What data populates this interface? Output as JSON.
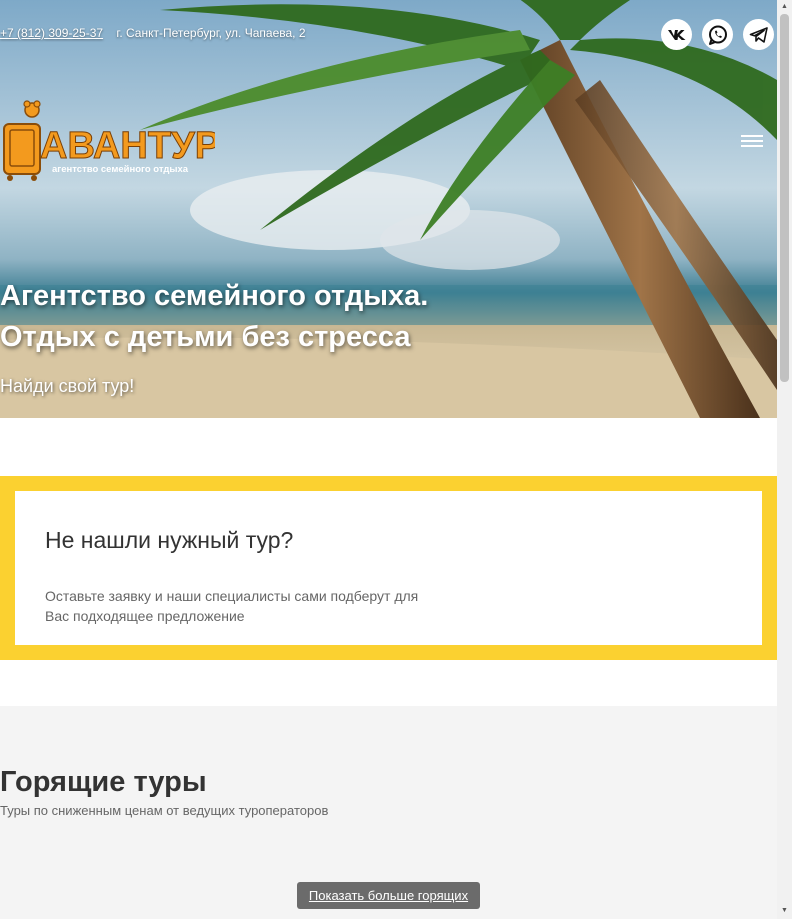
{
  "header": {
    "phone": "+7 (812) 309-25-37",
    "address": "г. Санкт-Петербург, ул. Чапаева, 2"
  },
  "social": [
    {
      "name": "vk-icon",
      "label": "VK"
    },
    {
      "name": "whatsapp-icon",
      "label": "WhatsApp"
    },
    {
      "name": "telegram-icon",
      "label": "Telegram"
    }
  ],
  "logo": {
    "name": "АВАНТУР",
    "tagline": "агентство семейного отдыха"
  },
  "hero": {
    "title": "Агентство семейного отдыха.\nОтдых с детьми без стресса",
    "subtitle": "Найди свой тур!"
  },
  "request_box": {
    "title": "Не нашли нужный тур?",
    "text": "Оставьте заявку и наши специалисты сами подберут для Вас подходящее предложение"
  },
  "hot_tours": {
    "title": "Горящие туры",
    "description": "Туры по сниженным ценам от ведущих туроператоров",
    "more_button": "Показать больше горящих"
  },
  "colors": {
    "accent_yellow": "#fbd130",
    "logo_orange": "#f39a1e",
    "button_gray": "#6b6b6b"
  }
}
